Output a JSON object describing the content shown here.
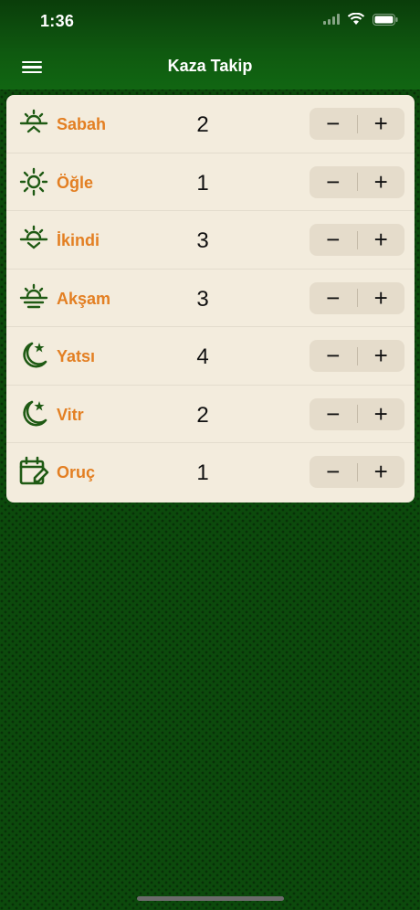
{
  "status": {
    "time": "1:36"
  },
  "nav": {
    "title": "Kaza Takip"
  },
  "items": [
    {
      "label": "Sabah",
      "count": "2",
      "icon": "sunrise-icon"
    },
    {
      "label": "Öğle",
      "count": "1",
      "icon": "sun-icon"
    },
    {
      "label": "İkindi",
      "count": "3",
      "icon": "sunset-icon"
    },
    {
      "label": "Akşam",
      "count": "3",
      "icon": "horizon-icon"
    },
    {
      "label": "Yatsı",
      "count": "4",
      "icon": "moon-star-icon"
    },
    {
      "label": "Vitr",
      "count": "2",
      "icon": "moon-star-icon"
    },
    {
      "label": "Oruç",
      "count": "1",
      "icon": "calendar-edit-icon"
    }
  ],
  "stepper": {
    "minus": "−",
    "plus": "+"
  },
  "colors": {
    "accent": "#e37f22",
    "green": "#0f5a10",
    "card": "#f3ecdd",
    "icon": "#1f5a14"
  }
}
